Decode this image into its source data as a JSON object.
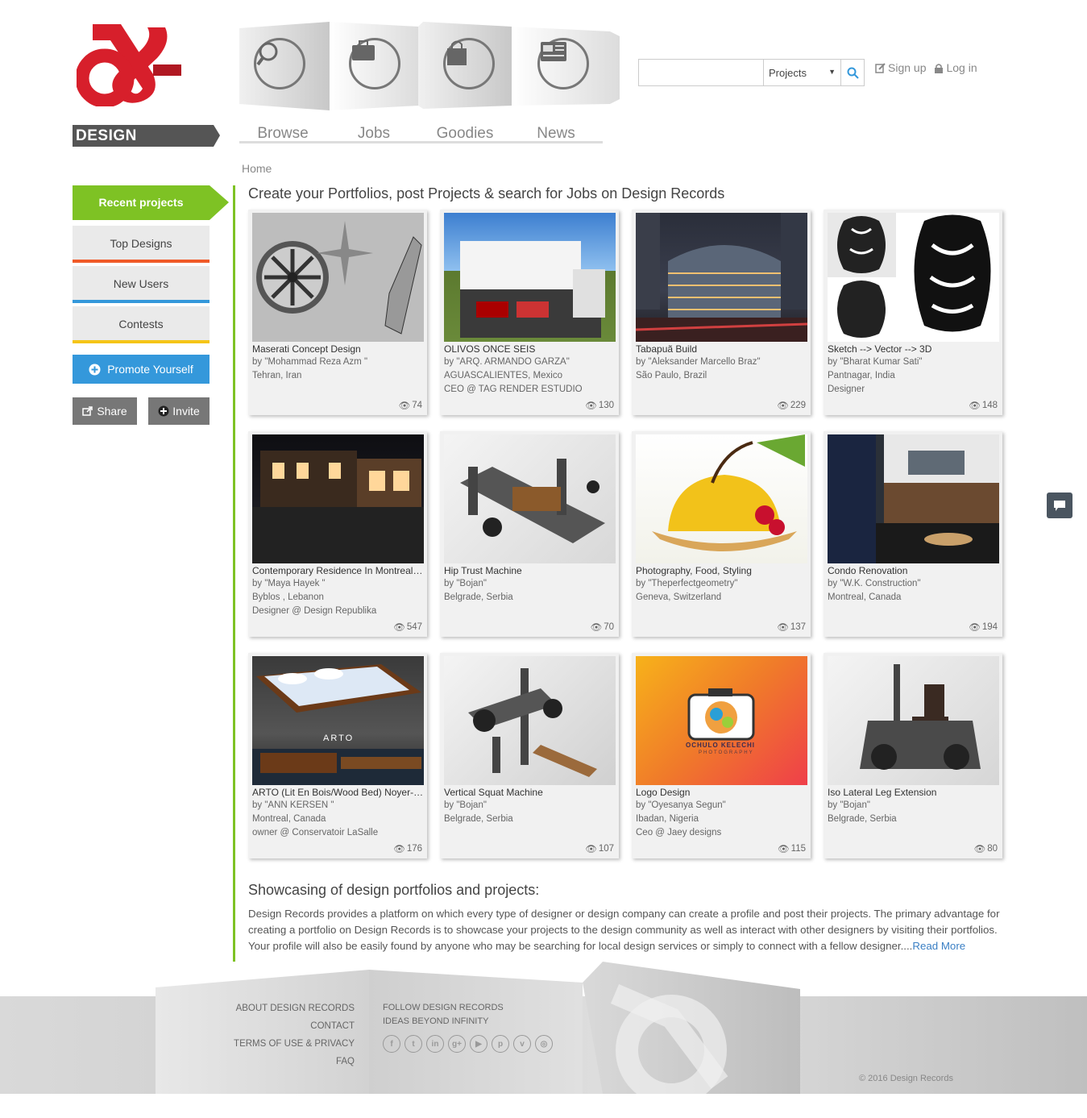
{
  "brand": {
    "name": "DESIGN RECORDS",
    "colors": {
      "red": "#d71f2b",
      "green": "#7ec224",
      "blue": "#3498db"
    }
  },
  "nav": {
    "items": [
      {
        "label": "Browse",
        "icon": "search-icon"
      },
      {
        "label": "Jobs",
        "icon": "briefcase-icon"
      },
      {
        "label": "Goodies",
        "icon": "shopping-bag-icon"
      },
      {
        "label": "News",
        "icon": "newspaper-icon"
      }
    ]
  },
  "search": {
    "placeholder": "",
    "category": "Projects"
  },
  "auth": {
    "signup": "Sign up",
    "login": "Log in"
  },
  "breadcrumb": "Home",
  "sidebar": {
    "recent": "Recent projects",
    "top_designs": "Top Designs",
    "new_users": "New Users",
    "contests": "Contests",
    "promote": "Promote Yourself",
    "share": "Share",
    "invite": "Invite"
  },
  "main": {
    "title": "Create your Portfolios, post Projects & search for Jobs on Design Records",
    "projects": [
      {
        "title": "Maserati Concept Design",
        "by": "by \"Mohammad Reza Azm \"",
        "location": "Tehran, Iran",
        "role": "",
        "views": "74"
      },
      {
        "title": "OLIVOS ONCE SEIS",
        "by": "by \"ARQ. ARMANDO GARZA\"",
        "location": "AGUASCALIENTES, Mexico",
        "role": "CEO @ TAG RENDER ESTUDIO",
        "views": "130"
      },
      {
        "title": "Tabapuã Build",
        "by": "by \"Aleksander Marcello Braz\"",
        "location": "São Paulo, Brazil",
        "role": "",
        "views": "229"
      },
      {
        "title": "Sketch --> Vector --> 3D",
        "by": "by \"Bharat Kumar Sati\"",
        "location": "Pantnagar, India",
        "role": "Designer",
        "views": "148"
      },
      {
        "title": "Contemporary Residence In Montreal's C...",
        "by": "by \"Maya Hayek \"",
        "location": "Byblos , Lebanon",
        "role": "Designer @ Design Republika",
        "views": "547"
      },
      {
        "title": "Hip Trust Machine",
        "by": "by \"Bojan\"",
        "location": "Belgrade, Serbia",
        "role": "",
        "views": "70"
      },
      {
        "title": "Photography, Food, Styling",
        "by": "by \"Theperfectgeometry\"",
        "location": "Geneva, Switzerland",
        "role": "",
        "views": "137"
      },
      {
        "title": "Condo Renovation",
        "by": "by \"W.K. Construction\"",
        "location": "Montreal, Canada",
        "role": "",
        "views": "194"
      },
      {
        "title": "ARTO (Lit En Bois/Wood Bed) Noyer-Wal...",
        "by": "by \"ANN KERSEN \"",
        "location": "Montreal, Canada",
        "role": "owner @ Conservatoir LaSalle",
        "views": "176"
      },
      {
        "title": "Vertical Squat Machine",
        "by": "by \"Bojan\"",
        "location": "Belgrade, Serbia",
        "role": "",
        "views": "107"
      },
      {
        "title": "Logo Design",
        "by": "by \"Oyesanya Segun\"",
        "location": "Ibadan, Nigeria",
        "role": "Ceo @ Jaey designs",
        "views": "115"
      },
      {
        "title": "Iso Lateral Leg Extension",
        "by": "by \"Bojan\"",
        "location": "Belgrade, Serbia",
        "role": "",
        "views": "80"
      }
    ],
    "thumb_text": {
      "arto": "ARTO",
      "logo_line1": "OCHULO KELECHI",
      "logo_line2": "PHOTOGRAPHY"
    }
  },
  "about": {
    "title": "Showcasing of design portfolios and projects:",
    "text": "Design Records provides a platform on which every type of designer or design company can create a profile and post their projects. The primary advantage for creating a portfolio on Design Records is to showcase your projects to the design community as well as interact with other designers by visiting their portfolios. Your profile will also be easily found by anyone who may be searching for local design services or simply to connect with a fellow designer....",
    "read_more": "Read More"
  },
  "footer": {
    "links": [
      "ABOUT DESIGN RECORDS",
      "CONTACT",
      "TERMS OF USE & PRIVACY",
      "FAQ"
    ],
    "follow": "FOLLOW DESIGN RECORDS",
    "tagline": "IDEAS BEYOND INFINITY",
    "social": [
      "facebook-icon",
      "twitter-icon",
      "linkedin-icon",
      "googleplus-icon",
      "youtube-icon",
      "pinterest-icon",
      "vimeo-icon",
      "instagram-icon"
    ],
    "copyright": "© 2016 Design Records"
  }
}
